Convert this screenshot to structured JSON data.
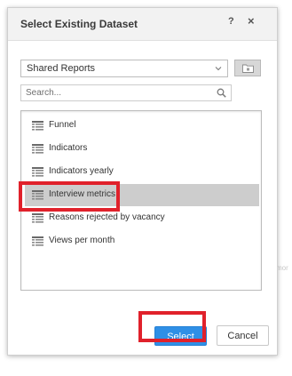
{
  "dialog": {
    "title": "Select Existing Dataset",
    "help_label": "?",
    "close_label": "×"
  },
  "source": {
    "selected": "Shared Reports"
  },
  "search": {
    "placeholder": "Search..."
  },
  "datasets": {
    "items": [
      {
        "label": "Funnel",
        "selected": false,
        "icon": "dataset-table-icon"
      },
      {
        "label": "Indicators",
        "selected": false,
        "icon": "dataset-table-icon"
      },
      {
        "label": "Indicators yearly",
        "selected": false,
        "icon": "dataset-table-icon"
      },
      {
        "label": "Interview metrics",
        "selected": true,
        "icon": "dataset-table-icon"
      },
      {
        "label": "Reasons rejected by vacancy",
        "selected": false,
        "icon": "dataset-table-icon"
      },
      {
        "label": "Views per month",
        "selected": false,
        "icon": "dataset-table-icon"
      }
    ]
  },
  "footer": {
    "select_label": "Select",
    "cancel_label": "Cancel"
  },
  "background": {
    "partial_text": "mor"
  },
  "colors": {
    "primary_button": "#2f8fe6",
    "highlight": "#e0212b",
    "selected_row": "#cdcdcd"
  }
}
